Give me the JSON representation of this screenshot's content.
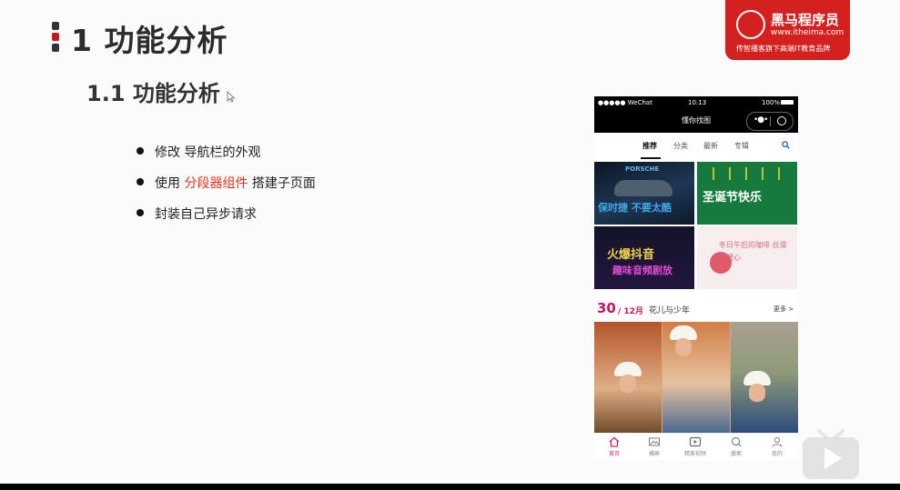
{
  "slide": {
    "title": "1 功能分析",
    "subtitle": "1.1 功能分析",
    "bullets": [
      {
        "before": "修改 导航栏的外观",
        "highlight": "",
        "after": ""
      },
      {
        "before": "使用 ",
        "highlight": "分段器组件",
        "after": " 搭建子页面"
      },
      {
        "before": "封装自己异步请求",
        "highlight": "",
        "after": ""
      }
    ],
    "highlight_color": "#e2311f"
  },
  "brand": {
    "name": "黑马程序员",
    "url": "www.itheima.com",
    "slogan": "传智播客旗下高端IT教育品牌",
    "color": "#d4201e"
  },
  "phone": {
    "status": {
      "carrier": "●●●●● WeChat",
      "time": "10:13",
      "battery": "100%"
    },
    "nav_title": "懂你找图",
    "capsule": {
      "menu_icon": "more-dots-icon",
      "close_icon": "target-circle-icon"
    },
    "tabs": [
      "推荐",
      "分类",
      "最新",
      "专辑"
    ],
    "active_tab": "推荐",
    "thumbnails": [
      {
        "text": "保时捷 不要太酷",
        "label": "PORSCHE"
      },
      {
        "text": "圣诞节快乐"
      },
      {
        "text_a": "火爆抖音",
        "text_b": "趣味音频剧放"
      },
      {
        "text": "冬日午后的咖啡 丝滑又暖心"
      }
    ],
    "date": {
      "day": "30",
      "month": "/ 12月",
      "title": "花儿与少年",
      "more": "更多 >"
    },
    "tabbar": [
      "首页",
      "横屏",
      "精美视频",
      "搜索",
      "我的"
    ],
    "tabbar_active": "首页",
    "accent": "#c2185b"
  }
}
